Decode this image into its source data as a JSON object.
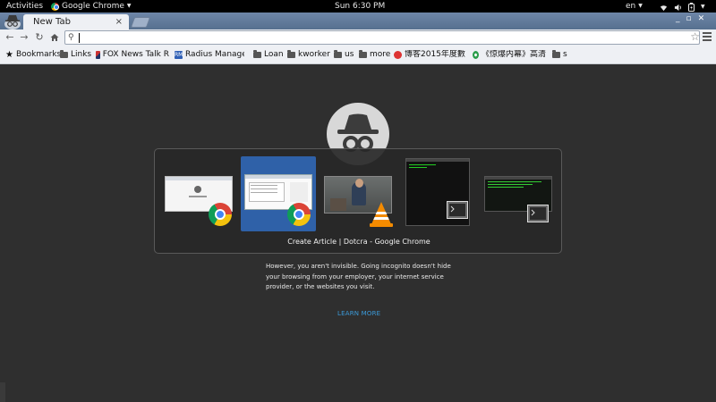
{
  "topbar": {
    "activities": "Activities",
    "app_name": "Google Chrome",
    "clock": "Sun  6:30 PM",
    "language": "en"
  },
  "tabs": [
    {
      "label": "New Tab",
      "close": "×"
    }
  ],
  "toolbar": {
    "omnibox_value": ""
  },
  "bookmarks": [
    {
      "label": "Bookmarks",
      "icon": "star-icon"
    },
    {
      "label": "Links",
      "icon": "folder-icon"
    },
    {
      "label": "FOX News Talk R",
      "icon": "fox-favicon"
    },
    {
      "label": "Radius Manager",
      "icon": "rm-favicon"
    },
    {
      "label": "Loan",
      "icon": "folder-icon"
    },
    {
      "label": "kworker",
      "icon": "folder-icon"
    },
    {
      "label": "us",
      "icon": "folder-icon"
    },
    {
      "label": "more",
      "icon": "folder-icon"
    },
    {
      "label": "博客2015年度數",
      "icon": "blog-favicon"
    },
    {
      "label": "《惊爆内幕》高清",
      "icon": "movie-favicon"
    },
    {
      "label": "s",
      "icon": "folder-icon"
    }
  ],
  "switcher": {
    "selected_title": "Create Article | Dotcra - Google Chrome",
    "windows": [
      {
        "app": "chrome",
        "selected": false
      },
      {
        "app": "chrome",
        "selected": true
      },
      {
        "app": "vlc",
        "selected": false
      },
      {
        "app": "terminal",
        "selected": false
      },
      {
        "app": "terminal",
        "selected": false
      }
    ]
  },
  "incognito": {
    "message": "However, you aren't invisible. Going incognito doesn't hide your browsing from your employer, your internet service provider, or the websites you visit.",
    "learn_more": "LEARN MORE"
  },
  "colors": {
    "content_bg": "#2f2f2f",
    "link": "#3b9ad9",
    "tabstrip": "#6e86a8"
  }
}
